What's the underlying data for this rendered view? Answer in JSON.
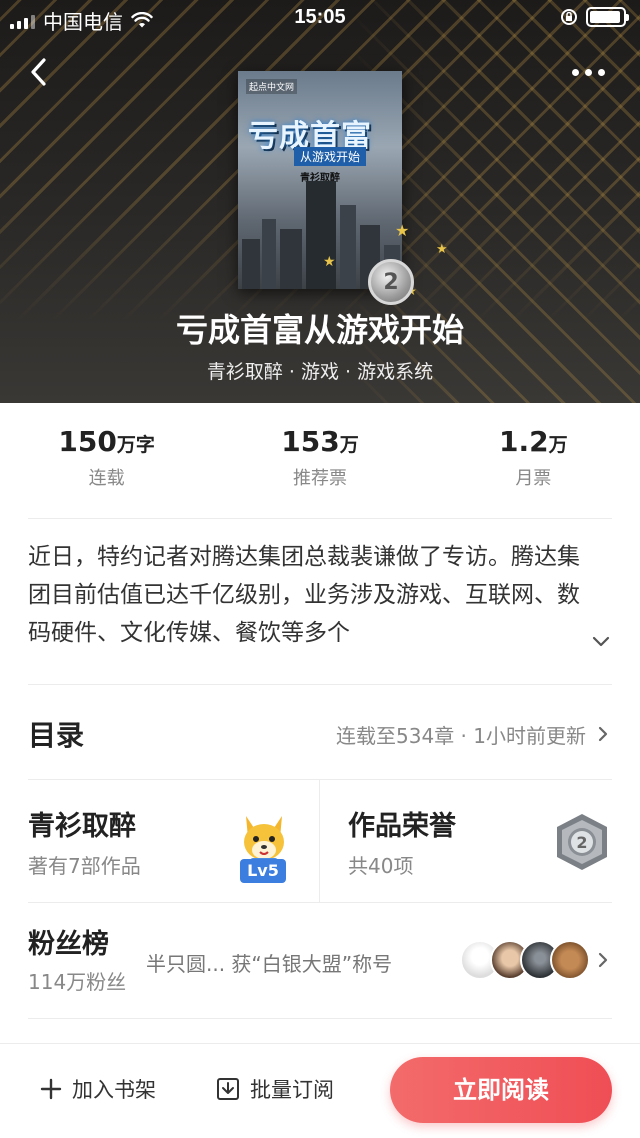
{
  "status_bar": {
    "carrier": "中国电信",
    "time": "15:05",
    "battery_level": 0.95
  },
  "header": {
    "back_icon": "chevron-left-icon",
    "more_icon": "more-dots-icon"
  },
  "book": {
    "cover": {
      "publisher_mark": "起点中文网",
      "title": "亏成首富",
      "subtitle": "从游戏开始",
      "author": "青衫取醉"
    },
    "rank_badge": "2",
    "title": "亏成首富从游戏开始",
    "meta": "青衫取醉 · 游戏 · 游戏系统"
  },
  "stats": [
    {
      "value": "150",
      "unit": "万字",
      "label": "连载"
    },
    {
      "value": "153",
      "unit": "万",
      "label": "推荐票"
    },
    {
      "value": "1.2",
      "unit": "万",
      "label": "月票"
    }
  ],
  "intro": "近日，特约记者对腾达集团总裁裴谦做了专访。腾达集团目前估值已达千亿级别，业务涉及游戏、互联网、数码硬件、文化传媒、餐饮等多个",
  "toc": {
    "title": "目录",
    "info": "连载至534章 · 1小时前更新"
  },
  "author_card": {
    "name": "青衫取醉",
    "works": "著有7部作品",
    "level": "Lv5"
  },
  "honor_card": {
    "title": "作品荣誉",
    "count": "共40项",
    "badge": "2"
  },
  "fans": {
    "title": "粉丝榜",
    "count": "114万粉丝",
    "message": "半只圆... 获“白银大盟”称号"
  },
  "bottom_bar": {
    "add_shelf": "加入书架",
    "batch_subscribe": "批量订阅",
    "read_now": "立即阅读"
  },
  "colors": {
    "accent": "#ef4e55",
    "level_tag": "#3c7de0"
  }
}
